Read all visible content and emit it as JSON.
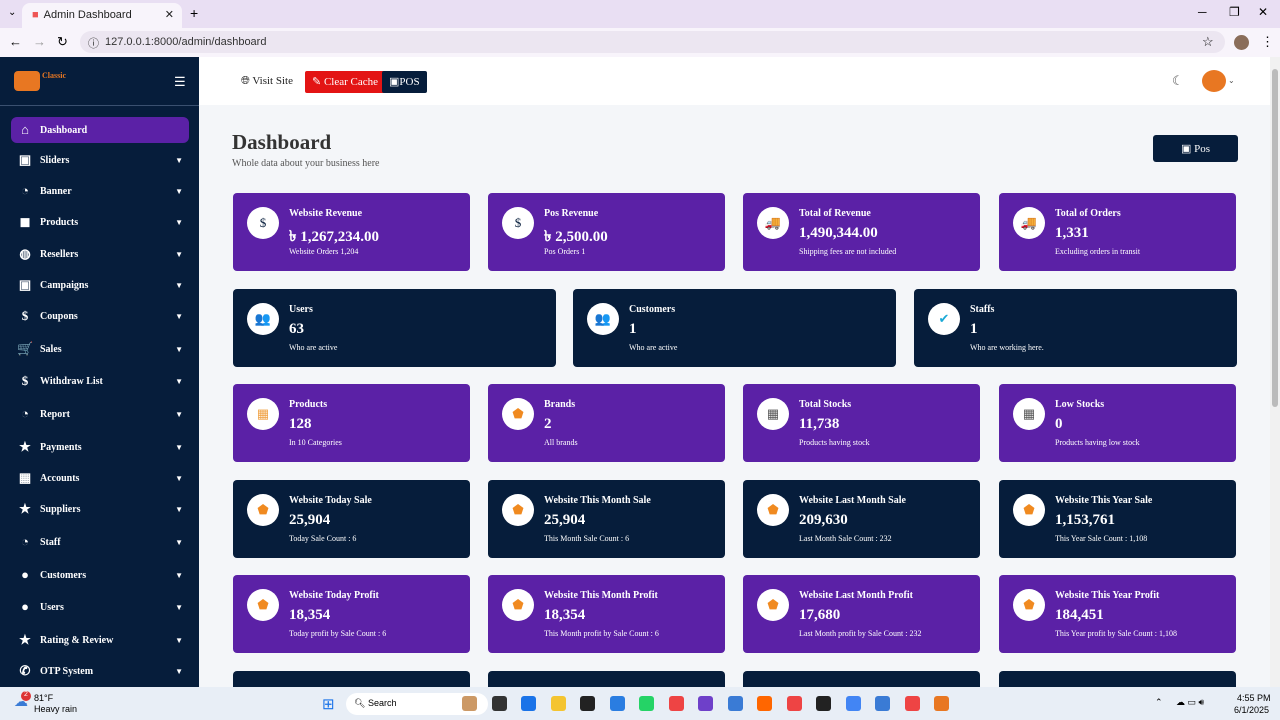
{
  "browser": {
    "tab_title": "Admin Dashboard",
    "url": "127.0.0.1:8000/admin/dashboard"
  },
  "sidebar": {
    "logo": "Classic",
    "items": [
      {
        "label": "Dashboard",
        "icon": "home-icon",
        "glyph": "⌂"
      },
      {
        "label": "Sliders",
        "icon": "images-icon",
        "glyph": "▣"
      },
      {
        "label": "Banner",
        "icon": "pie-icon",
        "glyph": "◔"
      },
      {
        "label": "Products",
        "icon": "bag-icon",
        "glyph": "◼"
      },
      {
        "label": "Resellers",
        "icon": "globe-icon",
        "glyph": "◍"
      },
      {
        "label": "Campaigns",
        "icon": "images-icon",
        "glyph": "▣"
      },
      {
        "label": "Coupons",
        "icon": "dollar-icon",
        "glyph": "$"
      },
      {
        "label": "Sales",
        "icon": "cart-icon",
        "glyph": "🛒"
      },
      {
        "label": "Withdraw List",
        "icon": "dollar-icon",
        "glyph": "$"
      },
      {
        "label": "Report",
        "icon": "pie-icon",
        "glyph": "◔"
      },
      {
        "label": "Payments",
        "icon": "star-icon",
        "glyph": "★"
      },
      {
        "label": "Accounts",
        "icon": "building-icon",
        "glyph": "▦"
      },
      {
        "label": "Suppliers",
        "icon": "star-icon",
        "glyph": "★"
      },
      {
        "label": "Staff",
        "icon": "pie-icon",
        "glyph": "◔"
      },
      {
        "label": "Customers",
        "icon": "user-icon",
        "glyph": "●"
      },
      {
        "label": "Users",
        "icon": "user-icon",
        "glyph": "●"
      },
      {
        "label": "Rating & Review",
        "icon": "star-icon",
        "glyph": "★"
      },
      {
        "label": "OTP System",
        "icon": "phone-icon",
        "glyph": "✆"
      }
    ]
  },
  "topbar": {
    "visit_site": "Visit Site",
    "clear_cache": "Clear Cache",
    "pos": "POS"
  },
  "page": {
    "title": "Dashboard",
    "subtitle": "Whole data about your business here",
    "pos_button": "Pos"
  },
  "cards": [
    {
      "title": "Website Revenue",
      "value": "৳ 1,267,234.00",
      "sub": "Website Orders 1,204",
      "style": "pur",
      "glyph": "$",
      "color": "#061d3b"
    },
    {
      "title": "Pos Revenue",
      "value": "৳ 2,500.00",
      "sub": "Pos Orders 1",
      "style": "pur",
      "glyph": "$",
      "color": "#061d3b"
    },
    {
      "title": "Total of Revenue",
      "value": "1,490,344.00",
      "sub": "Shipping fees are not included",
      "style": "pur",
      "glyph": "🚚",
      "color": "#22b14c"
    },
    {
      "title": "Total of Orders",
      "value": "1,331",
      "sub": "Excluding orders in transit",
      "style": "pur",
      "glyph": "🚚",
      "color": "#22b14c"
    },
    {
      "title": "Users",
      "value": "63",
      "sub": "Who are active",
      "style": "dk",
      "glyph": "👥",
      "color": "#1aa9d6"
    },
    {
      "title": "Customers",
      "value": "1",
      "sub": "Who are active",
      "style": "dk",
      "glyph": "👥",
      "color": "#1aa9d6"
    },
    {
      "title": "Staffs",
      "value": "1",
      "sub": "Who are working here.",
      "style": "dk",
      "glyph": "✔",
      "color": "#1aa9d6"
    },
    {
      "title": "Products",
      "value": "128",
      "sub": "In 10 Categories",
      "style": "pur",
      "glyph": "▦",
      "color": "#f0a040"
    },
    {
      "title": "Brands",
      "value": "2",
      "sub": "All brands",
      "style": "pur",
      "glyph": "⬟",
      "color": "#f08a20"
    },
    {
      "title": "Total Stocks",
      "value": "11,738",
      "sub": "Products having stock",
      "style": "pur",
      "glyph": "▦",
      "color": "#555"
    },
    {
      "title": "Low Stocks",
      "value": "0",
      "sub": "Products having low stock",
      "style": "pur",
      "glyph": "▦",
      "color": "#555"
    },
    {
      "title": "Website Today Sale",
      "value": "25,904",
      "sub": "Today Sale Count : 6",
      "style": "dk",
      "glyph": "⬟",
      "color": "#f08a20"
    },
    {
      "title": "Website This Month Sale",
      "value": "25,904",
      "sub": "This Month Sale Count : 6",
      "style": "dk",
      "glyph": "⬟",
      "color": "#f08a20"
    },
    {
      "title": "Website Last Month Sale",
      "value": "209,630",
      "sub": "Last Month Sale Count : 232",
      "style": "dk",
      "glyph": "⬟",
      "color": "#f08a20"
    },
    {
      "title": "Website This Year Sale",
      "value": "1,153,761",
      "sub": "This Year Sale Count : 1,108",
      "style": "dk",
      "glyph": "⬟",
      "color": "#f08a20"
    },
    {
      "title": "Website Today Profit",
      "value": "18,354",
      "sub": "Today profit by Sale Count : 6",
      "style": "pur",
      "glyph": "⬟",
      "color": "#f08a20"
    },
    {
      "title": "Website This Month Profit",
      "value": "18,354",
      "sub": "This Month profit by Sale Count : 6",
      "style": "pur",
      "glyph": "⬟",
      "color": "#f08a20"
    },
    {
      "title": "Website Last Month Profit",
      "value": "17,680",
      "sub": "Last Month profit by Sale Count : 232",
      "style": "pur",
      "glyph": "⬟",
      "color": "#f08a20"
    },
    {
      "title": "Website This Year Profit",
      "value": "184,451",
      "sub": "This Year profit by Sale Count : 1,108",
      "style": "pur",
      "glyph": "⬟",
      "color": "#f08a20"
    }
  ],
  "taskbar": {
    "temp": "81°F",
    "weather": "Heavy rain",
    "badge": "2",
    "search": "Search",
    "time": "4:55 PM",
    "date": "6/1/2025"
  }
}
